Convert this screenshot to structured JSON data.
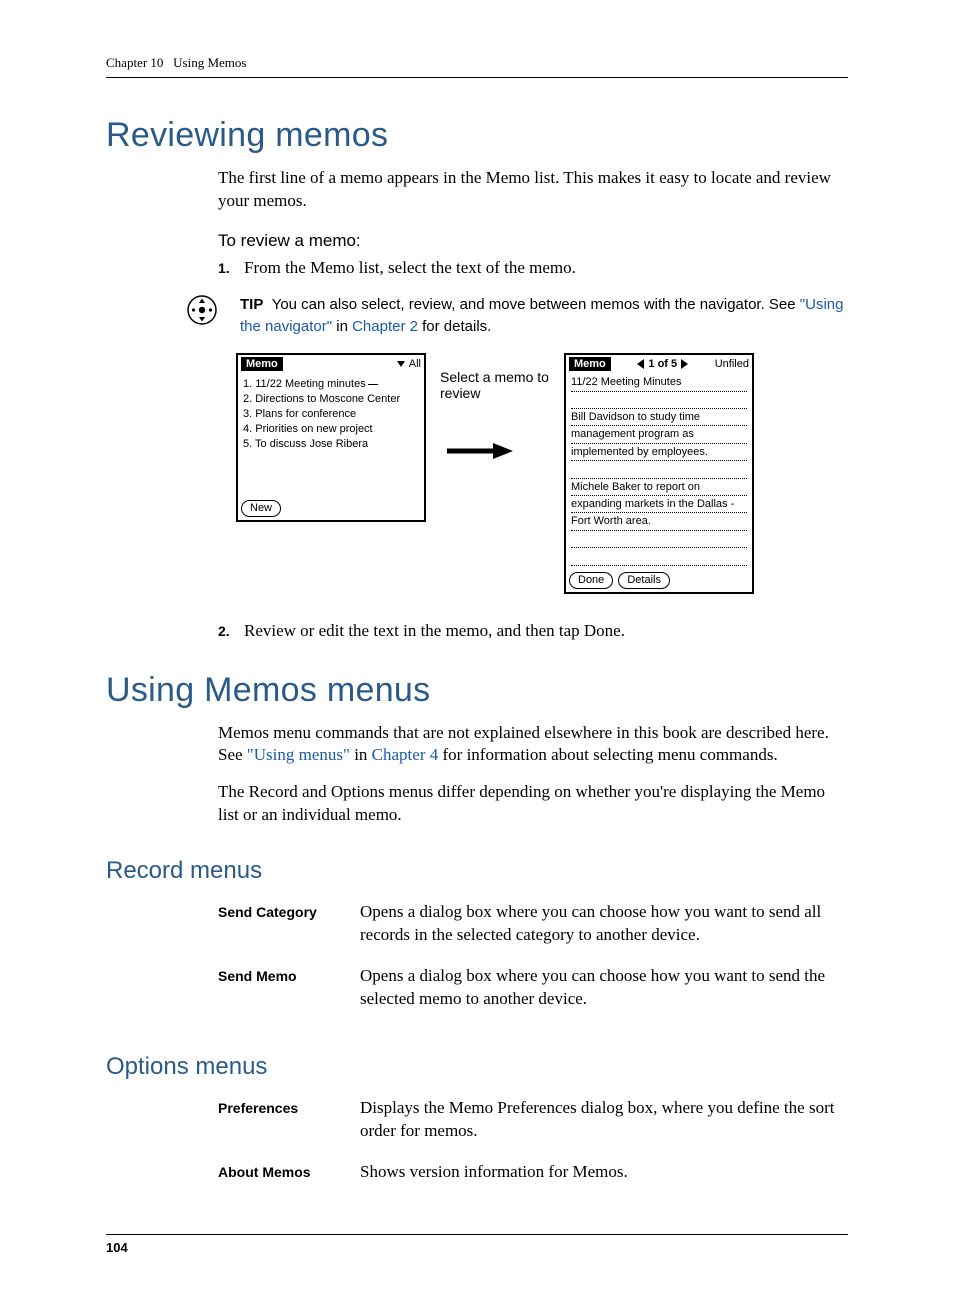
{
  "runningHead": {
    "chapter": "Chapter 10",
    "title": "Using Memos"
  },
  "section1": {
    "title": "Reviewing memos",
    "intro": "The first line of a memo appears in the Memo list. This makes it easy to locate and review your memos.",
    "taskHead": "To review a memo:",
    "step1": "From the Memo list, select the text of the memo.",
    "step1Num": "1.",
    "step2": "Review or edit the text in the memo, and then tap Done.",
    "step2Num": "2."
  },
  "tip": {
    "label": "TIP",
    "textBefore": "You can also select, review, and move between memos with the navigator. See ",
    "link1": "\"Using the navigator\"",
    "mid": " in ",
    "link2": "Chapter 2",
    "after": " for details."
  },
  "figure": {
    "annotation": "Select a memo to review",
    "listScreen": {
      "title": "Memo",
      "category": "All",
      "items": [
        "1. 11/22 Meeting minutes",
        "2. Directions to Moscone Center",
        "3. Plans for conference",
        "4. Priorities on new project",
        "5. To discuss Jose Ribera"
      ],
      "newBtn": "New"
    },
    "detailScreen": {
      "title": "Memo",
      "counter": "1 of 5",
      "category": "Unfiled",
      "line1": "11/22 Meeting Minutes",
      "para1a": "Bill Davidson to study time",
      "para1b": "management program as",
      "para1c": "implemented by employees.",
      "para2a": "Michele Baker to report on",
      "para2b": "expanding markets in the Dallas -",
      "para2c": "Fort Worth area.",
      "doneBtn": "Done",
      "detailsBtn": "Details"
    }
  },
  "section2": {
    "title": "Using Memos menus",
    "introBefore": "Memos menu commands that are not explained elsewhere in this book are described here. See ",
    "link1": "\"Using menus\"",
    "mid": " in ",
    "link2": "Chapter 4",
    "after": " for information about selecting menu commands.",
    "para2": "The Record and Options menus differ depending on whether you're displaying the Memo list or an individual memo."
  },
  "recordMenus": {
    "title": "Record menus",
    "rows": [
      {
        "term": "Send Category",
        "desc": "Opens a dialog box where you can choose how you want to send all records in the selected category to another device."
      },
      {
        "term": "Send Memo",
        "desc": "Opens a dialog box where you can choose how you want to send the selected memo to another device."
      }
    ]
  },
  "optionsMenus": {
    "title": "Options menus",
    "rows": [
      {
        "term": "Preferences",
        "desc": "Displays the Memo Preferences dialog box, where you define the sort order for memos."
      },
      {
        "term": "About Memos",
        "desc": "Shows version information for Memos."
      }
    ]
  },
  "pageNum": "104"
}
